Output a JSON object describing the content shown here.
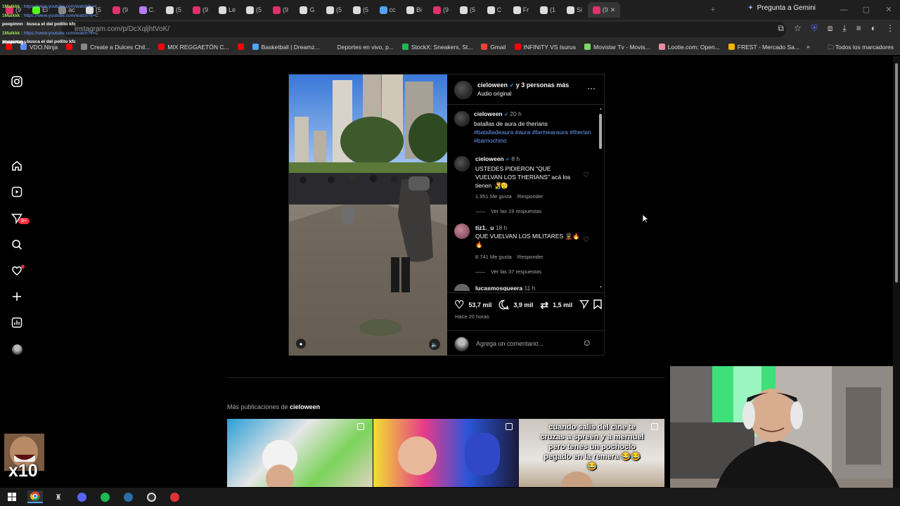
{
  "browser": {
    "tabs": [
      {
        "label": "(9",
        "icon": "instagram-icon"
      },
      {
        "label": "El",
        "icon": "kick-icon"
      },
      {
        "label": "ac",
        "icon": "globe-icon"
      },
      {
        "label": "(5",
        "icon": "tiktok-icon"
      },
      {
        "label": "(9",
        "icon": "instagram-icon"
      },
      {
        "label": "C.",
        "icon": "pen-icon"
      },
      {
        "label": "(5",
        "icon": "tiktok-icon"
      },
      {
        "label": "(9",
        "icon": "instagram-icon"
      },
      {
        "label": "Le",
        "icon": "tiktok-icon"
      },
      {
        "label": "(5",
        "icon": "tiktok-icon"
      },
      {
        "label": "(9",
        "icon": "instagram-icon"
      },
      {
        "label": "G",
        "icon": "tiktok-icon"
      },
      {
        "label": "(5",
        "icon": "tiktok-icon"
      },
      {
        "label": "(5",
        "icon": "tiktok-icon"
      },
      {
        "label": "cc",
        "icon": "translate-icon"
      },
      {
        "label": "Bi",
        "icon": "tiktok-icon"
      },
      {
        "label": "(9",
        "icon": "instagram-icon"
      },
      {
        "label": "(5",
        "icon": "tiktok-icon"
      },
      {
        "label": "C",
        "icon": "tiktok-icon"
      },
      {
        "label": "Fr",
        "icon": "tiktok-icon"
      },
      {
        "label": "(1",
        "icon": "x-icon"
      },
      {
        "label": "Si",
        "icon": "tiktok-icon"
      },
      {
        "label": "(9",
        "icon": "instagram-icon"
      }
    ],
    "gemini_label": "Pregunta a Gemini",
    "url": "instagram.com/p/DcXqljhtVoK/",
    "bookmarks": [
      {
        "label": "",
        "color": "#ff0000"
      },
      {
        "label": "VDO.Ninja",
        "color": "#5c8dff"
      },
      {
        "label": "",
        "color": "#ff0000"
      },
      {
        "label": "Create a Dulces Chil...",
        "color": "#888888"
      },
      {
        "label": "MIX REGGAETÓN C...",
        "color": "#ff0000"
      },
      {
        "label": "",
        "color": "#ff0000"
      },
      {
        "label": "Basketball | Dreamz...",
        "color": "#4ea3ff"
      },
      {
        "label": "Deportes en vivo, p...",
        "color": "#2b2b2b"
      },
      {
        "label": "StockX: Sneakers, St...",
        "color": "#1db954"
      },
      {
        "label": "Gmail",
        "color": "#ea4335"
      },
      {
        "label": "INFINITY VS Isurus",
        "color": "#ff0000"
      },
      {
        "label": "Movistar Tv - Movis...",
        "color": "#7cd86b"
      },
      {
        "label": "Lootie.com: Open...",
        "color": "#e88ca0"
      },
      {
        "label": "FREST - Mercado Sa...",
        "color": "#f4b400"
      }
    ],
    "all_bookmarks": "Todos los marcadores"
  },
  "chat": [
    {
      "user": "1Malkkk",
      "text": "https://www.youtube.com/watch?v=t",
      "type": "link"
    },
    {
      "user": "1Malkkk",
      "text": "https://www.youtube.com/watch?v=C",
      "type": "link"
    },
    {
      "user": "poopinnn",
      "text": "busca el del pollito kfc",
      "type": "text"
    },
    {
      "user": "1Malkkk",
      "text": "https://www.youtube.com/watch?v=C",
      "type": "link"
    },
    {
      "user": "poopinnn",
      "text": "busca el del pollito kfc",
      "type": "text"
    }
  ],
  "chat_extra_user": "Masterlago",
  "post": {
    "author": "cieloween",
    "coauthors": "y 3 personas más",
    "audio": "Audio original",
    "caption": {
      "user": "cieloween",
      "time": "20 h",
      "text": "batallas de aura de therians",
      "hashtags": "#batalladeaura #aura #farmearaura #therian #barriochino"
    },
    "comments": [
      {
        "user": "cieloween",
        "time": "8 h",
        "text": "USTEDES PIDIERON \"QUE VUELVAN LOS THERIANS\" acá los tienen 🧏‍♂️🫡",
        "likes": "1.951 Me gusta",
        "reply": "Responder",
        "replies": "Ver las 19 respuestas"
      },
      {
        "user": "tiz1._u",
        "time": "18 h",
        "text": "QUE VUELVAN LOS MILITARES 💂‍♂️🔥🔥",
        "likes": "8.741 Me gusta",
        "reply": "Responder",
        "replies": "Ver las 37 respuestas"
      },
      {
        "user": "lucasmosqueera",
        "time": "11 h",
        "text": ""
      }
    ],
    "stats": {
      "likes": "53,7 mil",
      "comments": "3,9 mil",
      "reposts": "1,5 mil"
    },
    "posted_ago": "Hace 20 horas",
    "comment_placeholder": "Agrega un comentario..."
  },
  "more_posts": {
    "prefix": "Más publicaciones de",
    "user": "cieloween",
    "thumb3_text": "cuando salis del cine te cruzas a spreen y a mernuel pero tenes un pochoclo pegado en la remera 😂😂😂"
  },
  "overlay": {
    "multiplier": "x10"
  },
  "colors": {
    "badge": "#ff3040",
    "hashtag": "#6e9cf7",
    "verified": "#1d9bf0"
  }
}
